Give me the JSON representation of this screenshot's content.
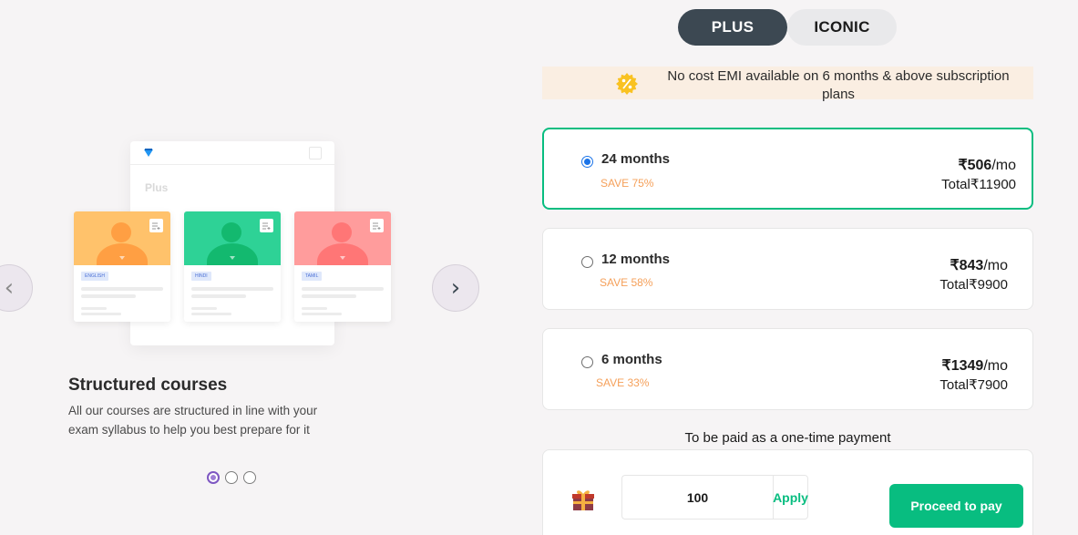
{
  "carousel": {
    "prev_icon": "chevron-left-icon",
    "next_icon": "chevron-right-icon",
    "prev_glyph": "‹",
    "next_glyph": "›",
    "mock_title": "Plus",
    "cards": [
      {
        "lang": "ENGLISH",
        "color": "#ffc26b",
        "dark": "#ff9f43"
      },
      {
        "lang": "HINDI",
        "color": "#2ed296",
        "dark": "#13b96f"
      },
      {
        "lang": "TAMIL",
        "color": "#ff9c9c",
        "dark": "#ff7676"
      }
    ],
    "slide_title": "Structured courses",
    "slide_description": "All our courses are structured in line with your exam syllabus to help you best prepare for it",
    "active_dot": 0,
    "dot_count": 3
  },
  "tabs": {
    "plus_label": "PLUS",
    "iconic_label": "ICONIC",
    "active": "PLUS"
  },
  "emi_banner": {
    "icon": "percent-badge-icon",
    "text": "No cost EMI available on 6 months & above subscription plans"
  },
  "plans": [
    {
      "duration": "24 months",
      "save": "SAVE 75%",
      "price": "₹506",
      "per": "/mo",
      "total": "Total₹11900",
      "selected": true
    },
    {
      "duration": "12 months",
      "save": "SAVE 58%",
      "price": "₹843",
      "per": "/mo",
      "total": "Total₹9900",
      "selected": false
    },
    {
      "duration": "6 months",
      "save": "SAVE 33%",
      "price": "₹1349",
      "per": "/mo",
      "total": "Total₹7900",
      "selected": false
    }
  ],
  "payment": {
    "one_time_note": "To be paid as a one-time payment",
    "gift_icon": "gift-icon",
    "coupon_value": "100",
    "apply_label": "Apply",
    "proceed_label": "Proceed to pay"
  },
  "colors": {
    "accent_green": "#08bd80",
    "tab_dark": "#3c4852",
    "save_orange": "#f5a05a",
    "radio_blue": "#1a73e8",
    "emi_bg": "#faeee2"
  }
}
